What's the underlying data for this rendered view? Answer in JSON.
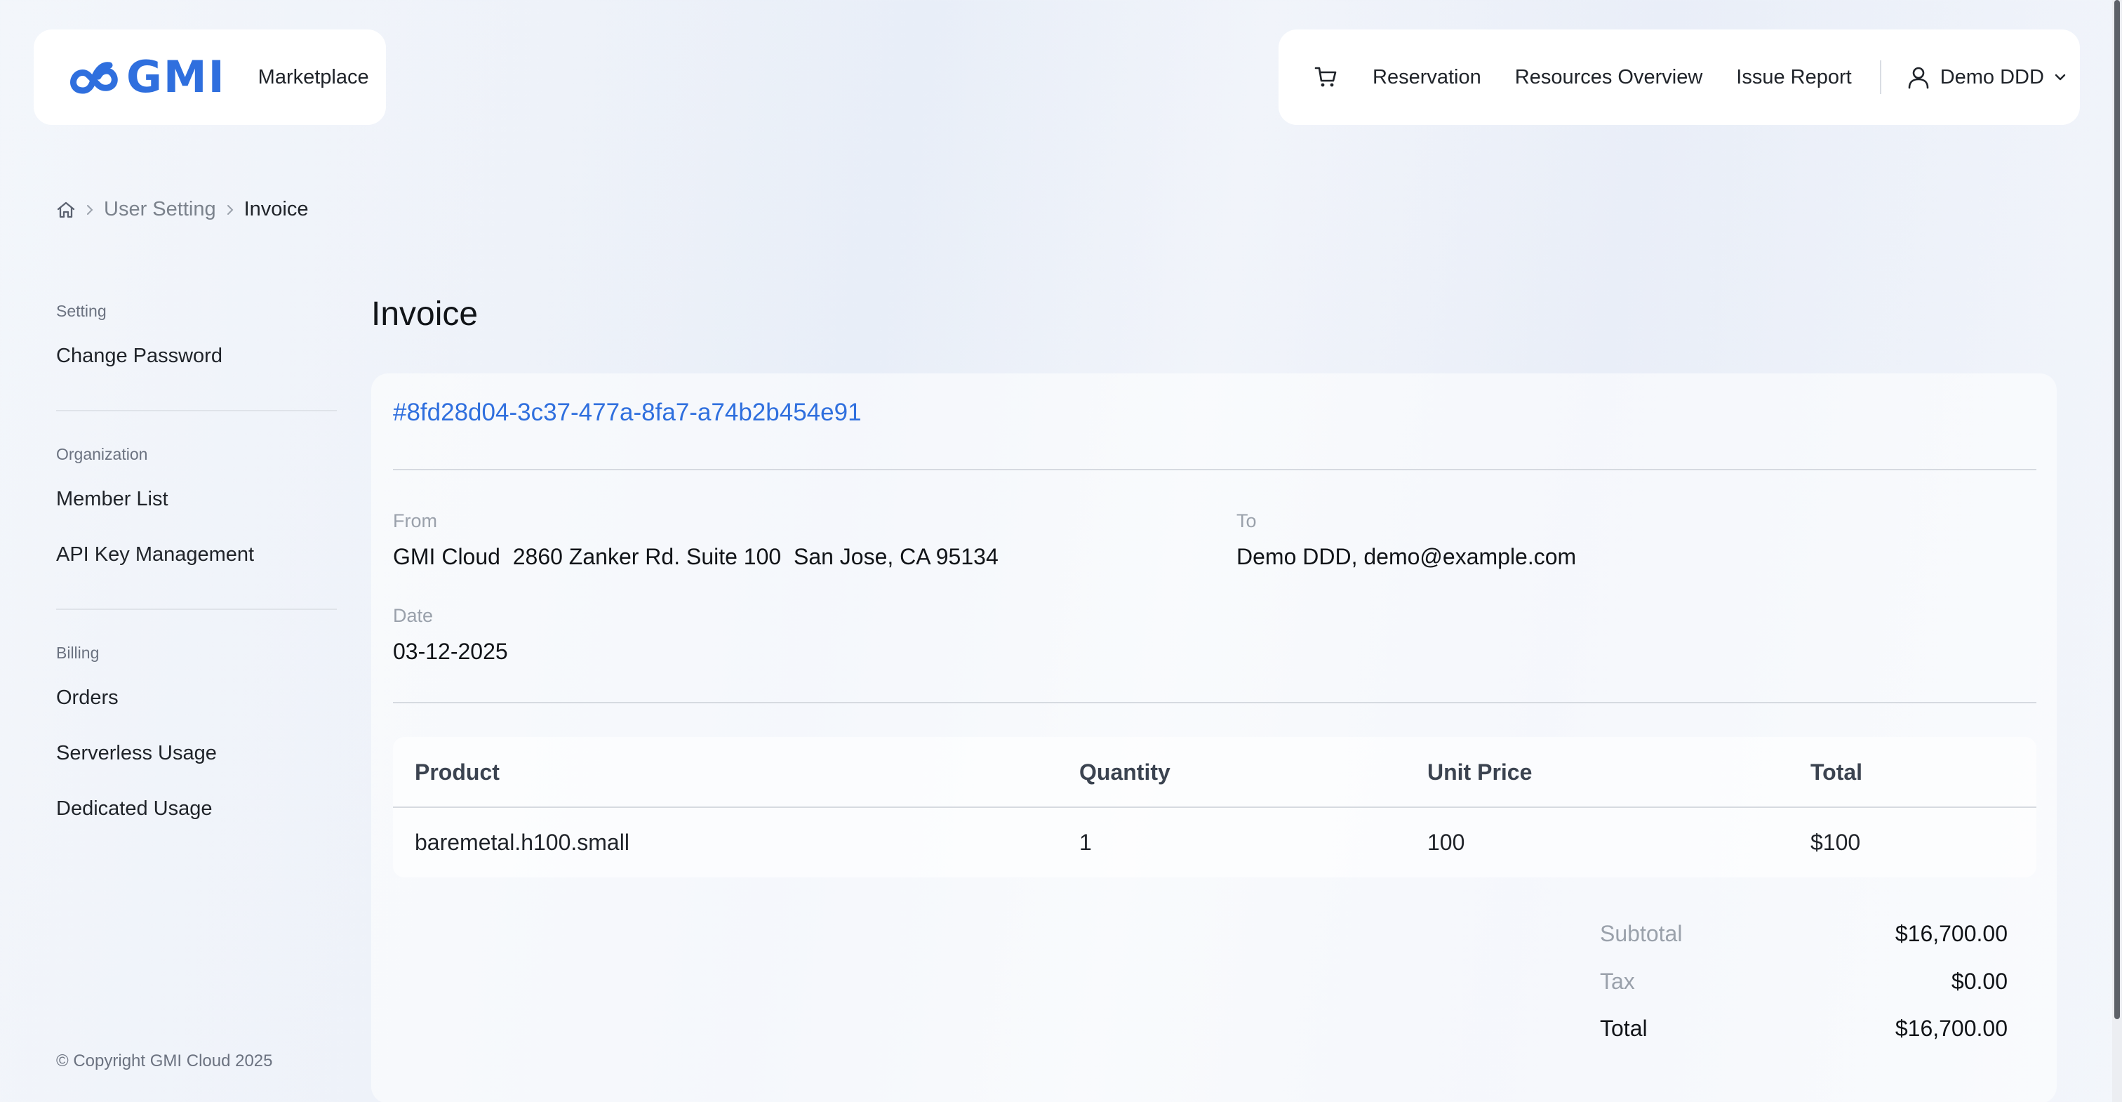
{
  "header": {
    "logo_text": "GMI",
    "marketplace_label": "Marketplace",
    "nav": {
      "reservation": "Reservation",
      "resources_overview": "Resources Overview",
      "issue_report": "Issue Report",
      "user_name": "Demo DDD"
    },
    "brand_color": "#2f6fde"
  },
  "breadcrumb": {
    "items": [
      "User Setting",
      "Invoice"
    ]
  },
  "sidebar": {
    "sections": [
      {
        "title": "Setting",
        "items": [
          "Change Password"
        ]
      },
      {
        "title": "Organization",
        "items": [
          "Member List",
          "API Key Management"
        ]
      },
      {
        "title": "Billing",
        "items": [
          "Orders",
          "Serverless Usage",
          "Dedicated Usage"
        ]
      }
    ],
    "copyright": "© Copyright GMI Cloud 2025"
  },
  "main": {
    "title": "Invoice",
    "invoice_id": "#8fd28d04-3c37-477a-8fa7-a74b2b454e91",
    "from_label": "From",
    "from_value": "GMI Cloud  2860 Zanker Rd. Suite 100  San Jose, CA 95134",
    "to_label": "To",
    "to_value": "Demo DDD, demo@example.com",
    "date_label": "Date",
    "date_value": "03-12-2025",
    "table": {
      "headers": [
        "Product",
        "Quantity",
        "Unit Price",
        "Total"
      ],
      "rows": [
        [
          "baremetal.h100.small",
          "1",
          "100",
          "$100"
        ]
      ]
    },
    "summary": {
      "subtotal_label": "Subtotal",
      "subtotal_value": "$16,700.00",
      "tax_label": "Tax",
      "tax_value": "$0.00",
      "total_label": "Total",
      "total_value": "$16,700.00"
    }
  }
}
